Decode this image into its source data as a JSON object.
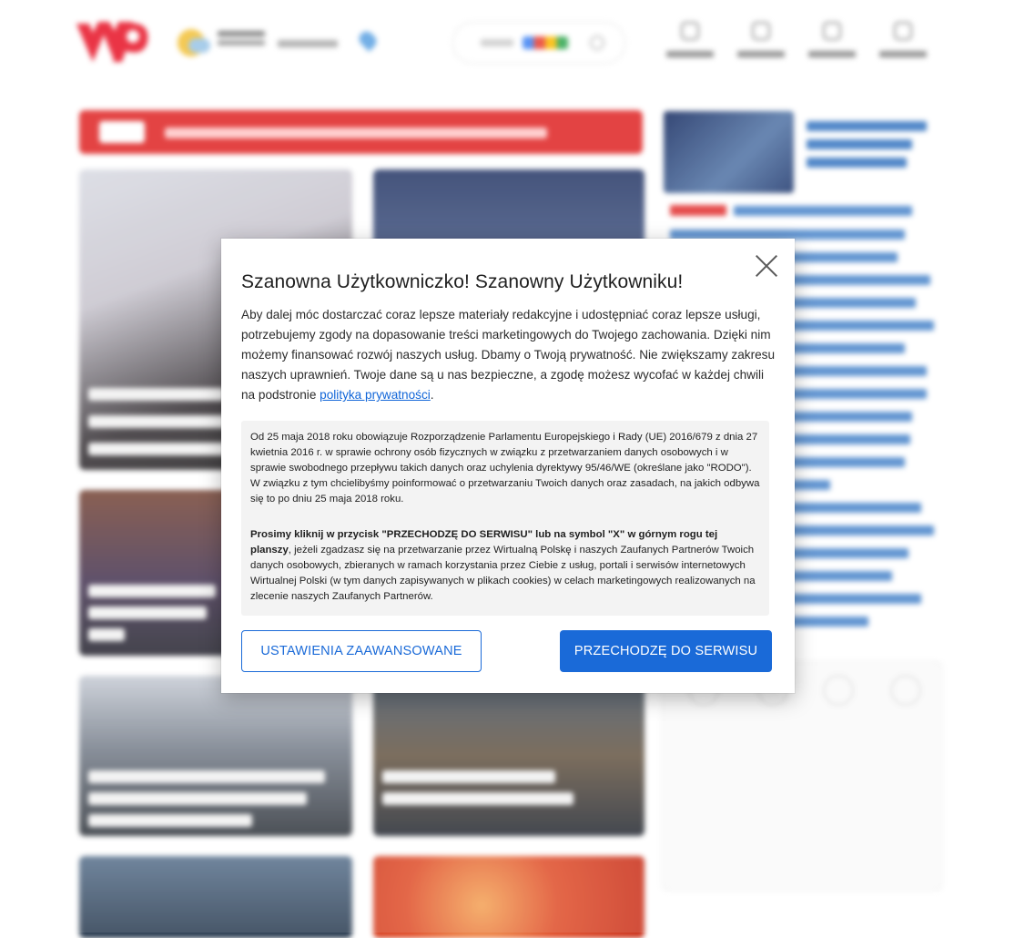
{
  "modal": {
    "title": "Szanowna Użytkowniczko! Szanowny Użytkowniku!",
    "intro_text": "Aby dalej móc dostarczać coraz lepsze materiały redakcyjne i udostępniać coraz lepsze usługi, potrzebujemy zgody na dopasowanie treści marketingowych do Twojego zachowania. Dzięki nim możemy finansować rozwój naszych usług. Dbamy o Twoją prywatność. Nie zwiększamy zakresu naszych uprawnień. Twoje dane są u nas bezpieczne, a zgodę możesz wycofać w każdej chwili na podstronie ",
    "privacy_link": "polityka prywatności",
    "intro_end": ".",
    "legal_paragraph_1": "Od 25 maja 2018 roku obowiązuje Rozporządzenie Parlamentu Europejskiego i Rady (UE) 2016/679 z dnia 27 kwietnia 2016 r. w sprawie ochrony osób fizycznych w związku z przetwarzaniem danych osobowych i w sprawie swobodnego przepływu takich danych oraz uchylenia dyrektywy 95/46/WE (określane jako \"RODO\"). W związku z tym chcielibyśmy poinformować o przetwarzaniu Twoich danych oraz zasadach, na jakich odbywa się to po dniu 25 maja 2018 roku.",
    "legal_bold": "Prosimy kliknij w przycisk \"PRZECHODZĘ DO SERWISU\" lub na symbol \"X\" w górnym rogu tej planszy",
    "legal_paragraph_2": ", jeżeli zgadzasz się na przetwarzanie przez Wirtualną Polskę i naszych Zaufanych Partnerów Twoich danych osobowych, zbieranych w ramach korzystania przez Ciebie z usług, portali i serwisów internetowych Wirtualnej Polski (w tym danych zapisywanych w plikach cookies) w celach marketingowych realizowanych na zlecenie naszych Zaufanych Partnerów.",
    "advanced_button": "USTAWIENIA ZAAWANSOWANE",
    "proceed_button": "PRZECHODZĘ DO SERWISU"
  },
  "colors": {
    "primary_blue": "#1a6ad8",
    "brand_red": "#e02a2a",
    "legal_bg": "#f3f3f3"
  },
  "icons": {
    "close": "close-icon",
    "logo": "wp-logo"
  }
}
